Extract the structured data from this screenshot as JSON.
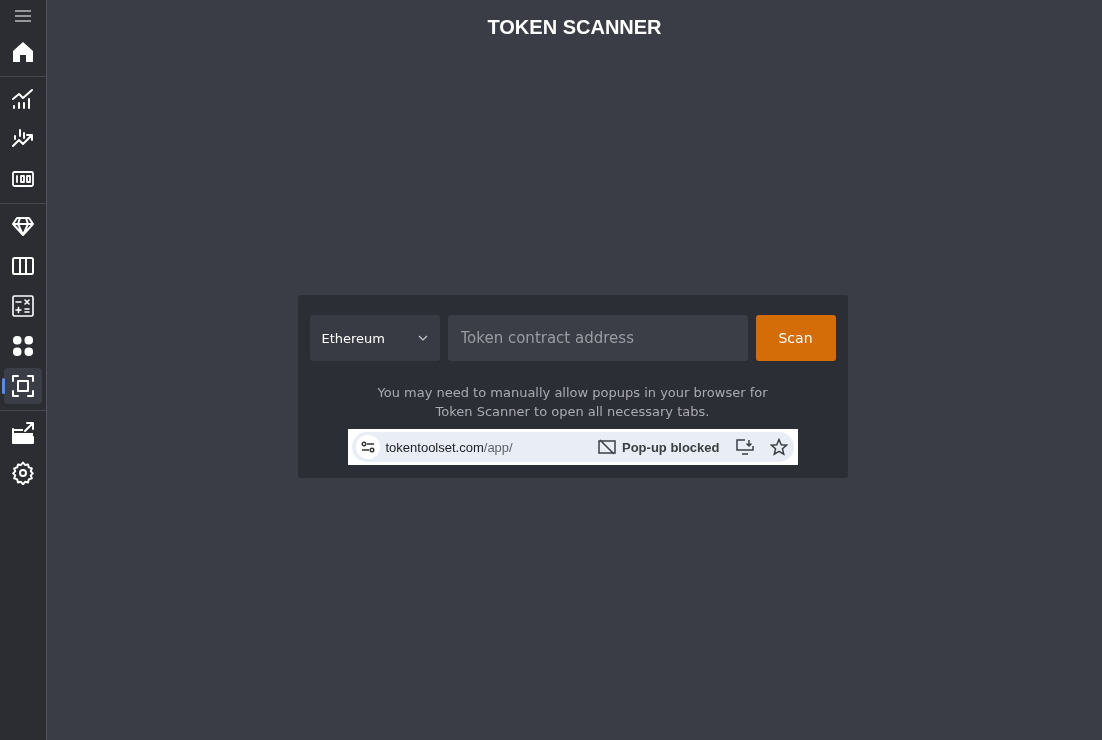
{
  "sidebar": {
    "groups": [
      [
        {
          "kind": "home",
          "selected": false
        }
      ],
      [
        {
          "kind": "chart",
          "selected": false
        },
        {
          "kind": "trend",
          "selected": false
        },
        {
          "kind": "counter",
          "selected": false
        }
      ],
      [
        {
          "kind": "diamond",
          "selected": false
        },
        {
          "kind": "columns",
          "selected": false
        },
        {
          "kind": "calculator",
          "selected": false
        },
        {
          "kind": "grid",
          "selected": false
        },
        {
          "kind": "scan",
          "selected": true
        }
      ],
      [
        {
          "kind": "external",
          "selected": false
        },
        {
          "kind": "settings",
          "selected": false
        }
      ]
    ]
  },
  "title": "TOKEN SCANNER",
  "scanner": {
    "network": "Ethereum",
    "address_placeholder": "Token contract address",
    "scan_button": "Scan",
    "note": "You may need to manually allow popups in your browser for Token Scanner to open all necessary tabs.",
    "browser_bar": {
      "host": "tokentoolset.com",
      "path": "/app/",
      "popup_status": "Pop-up blocked"
    }
  }
}
